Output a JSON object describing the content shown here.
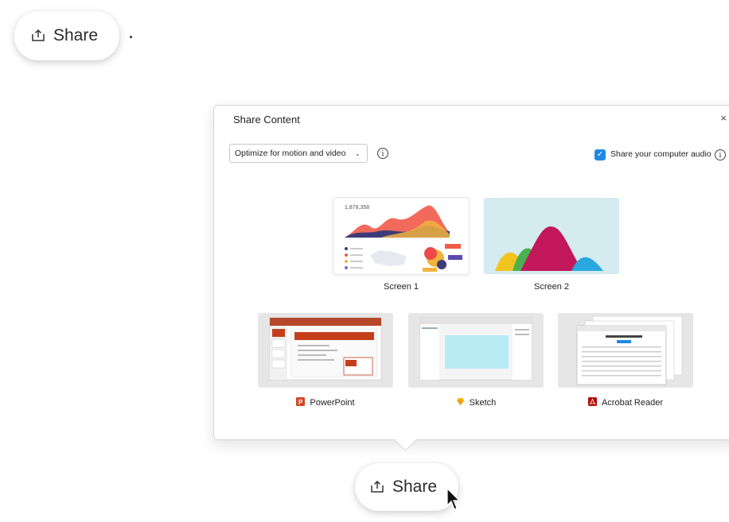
{
  "top_button": {
    "label": "Share",
    "icon": "share-upload-icon",
    "trailing_dot": "."
  },
  "dialog": {
    "title": "Share Content",
    "close_label": "×",
    "optimize_select": {
      "value": "Optimize for motion and video",
      "chevron": "chevron-down-icon"
    },
    "info_glyph": "i",
    "audio_checkbox": {
      "checked": true,
      "check_glyph": "✓",
      "label": "Share your computer audio"
    },
    "screens": [
      {
        "label": "Screen 1",
        "thumb_number": "1,878,358"
      },
      {
        "label": "Screen 2"
      }
    ],
    "apps": [
      {
        "label": "PowerPoint",
        "icon": "powerpoint-icon"
      },
      {
        "label": "Sketch",
        "icon": "sketch-icon"
      },
      {
        "label": "Acrobat Reader",
        "icon": "acrobat-reader-icon"
      }
    ]
  },
  "bottom_button": {
    "label": "Share",
    "icon": "share-upload-icon"
  },
  "colors": {
    "accent": "#1e88e5",
    "powerpoint": "#d24726",
    "sketch": "#f7b500",
    "acrobat": "#b30b00",
    "screen2_bg": "#d4ebef"
  }
}
